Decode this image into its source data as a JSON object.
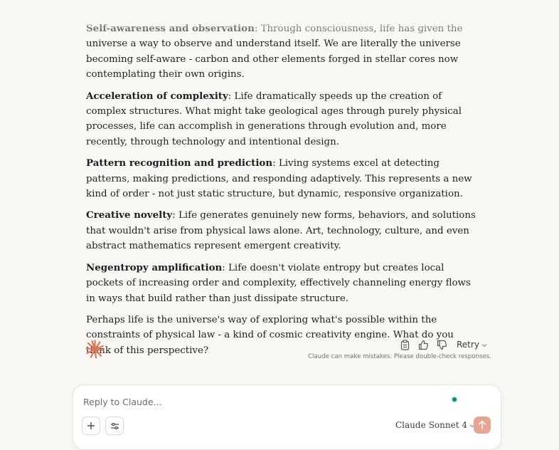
{
  "message": {
    "paragraphs": [
      {
        "term": "Self-awareness and observation",
        "text": ": Through consciousness, life has given the universe a way to observe and understand itself. We are literally the universe becoming self-aware - carbon and other elements forged in stellar cores now contemplating their own origins."
      },
      {
        "term": "Acceleration of complexity",
        "text": ": Life dramatically speeds up the creation of complex structures. What might take geological ages through purely physical processes, life can accomplish in generations through evolution and, more recently, through technology and intentional design."
      },
      {
        "term": "Pattern recognition and prediction",
        "text": ": Living systems excel at detecting patterns, making predictions, and responding adaptively. This represents a new kind of order - not just static structure, but dynamic, responsive organization."
      },
      {
        "term": "Creative novelty",
        "text": ": Life generates genuinely new forms, behaviors, and solutions that wouldn't arise from physical laws alone. Art, technology, culture, and even abstract mathematics represent emergent creativity."
      },
      {
        "term": "Negentropy amplification",
        "text": ": Life doesn't violate entropy but creates local pockets of increasing order and complexity, effectively channeling energy flows in ways that build rather than just dissipate structure."
      }
    ],
    "closing": "Perhaps life is the universe's way of exploring what's possible within the constraints of physical law - a kind of cosmic creativity engine. What do you think of this perspective?"
  },
  "actions": {
    "copy_icon": "clipboard-icon",
    "thumbs_up_icon": "thumbs-up-icon",
    "thumbs_down_icon": "thumbs-down-icon",
    "retry_label": "Retry"
  },
  "disclaimer": "Claude can make mistakes. Please double-check responses.",
  "composer": {
    "placeholder": "Reply to Claude...",
    "model_name": "Claude",
    "model_variant": "Sonnet 4"
  },
  "colors": {
    "background": "#f9f8f5",
    "logo": "#d97757",
    "send_button": "#e8a391",
    "status_dot": "#0e8a7c"
  }
}
